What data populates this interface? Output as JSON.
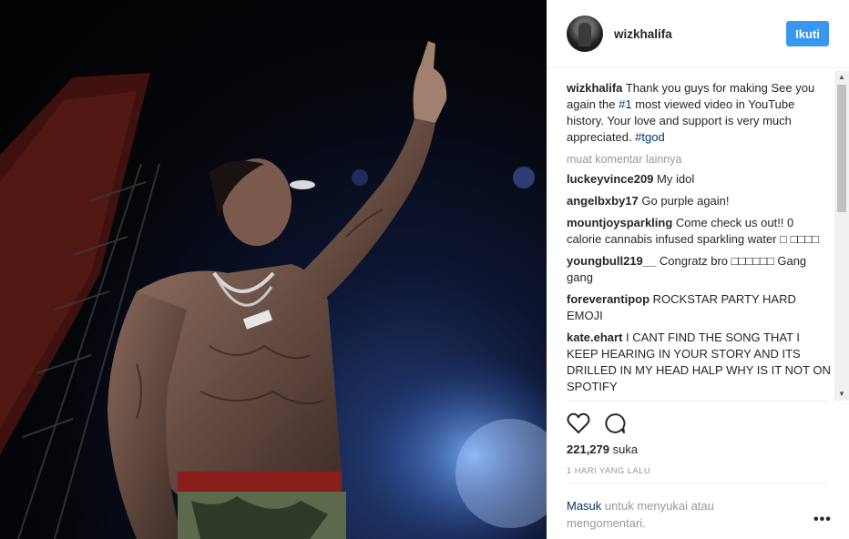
{
  "post": {
    "photo_alt": "Shirtless tattooed performer on stage pointing upward",
    "username": "wizkhalifa",
    "follow_label": "Ikuti"
  },
  "caption": {
    "username": "wizkhalifa",
    "text_before": "Thank you guys for making See you again the ",
    "hashtag1": "#1",
    "text_middle": " most viewed video in YouTube history. Your love and support is very much appreciated. ",
    "hashtag2": "#tgod"
  },
  "load_more": "muat komentar lainnya",
  "comments": [
    {
      "user": "luckeyvince209",
      "text": "My idol"
    },
    {
      "user": "angelbxby17",
      "text": "Go purple again!"
    },
    {
      "user": "mountjoysparkling",
      "text": "Come check us out!! 0 calorie cannabis infused sparkling water □ □□□□"
    },
    {
      "user": "youngbull219__",
      "text": "Congratz bro □□□□□□ Gang gang"
    },
    {
      "user": "foreverantipop",
      "text": "ROCKSTAR PARTY HARD EMOJI"
    },
    {
      "user": "kate.ehart",
      "text": "I CANT FIND THE SONG THAT I KEEP HEARING IN YOUR STORY AND ITS DRILLED IN MY HEAD HALP WHY IS IT NOT ON SPOTIFY"
    }
  ],
  "actions": {
    "like_icon": "heart-icon",
    "comment_icon": "comment-bubble-icon"
  },
  "likes": {
    "count": "221,279",
    "label": "suka"
  },
  "timestamp": "1 HARI YANG LALU",
  "login_prompt": {
    "link": "Masuk",
    "text": " untuk menyukai atau mengomentari."
  },
  "more_options": "•••",
  "colors": {
    "accent": "#3897f0",
    "link": "#003569",
    "muted": "#999999"
  }
}
